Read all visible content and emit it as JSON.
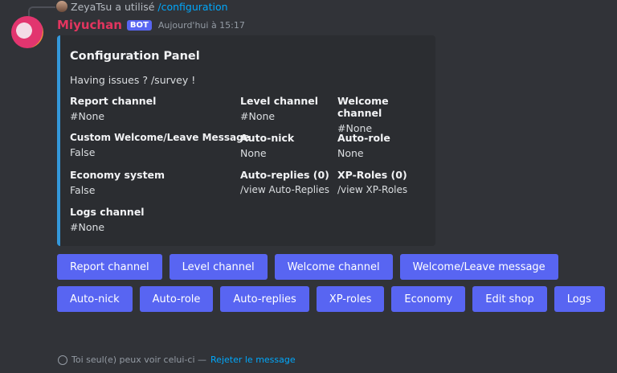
{
  "reply": {
    "user": "ZeyaTsu",
    "action": "a utilisé",
    "command": "/configuration"
  },
  "message": {
    "author": "Miyuchan",
    "badge": "BOT",
    "timestamp": "Aujourd'hui à 15:17"
  },
  "embed": {
    "color": "#3498db",
    "title": "Configuration Panel",
    "description": "Having issues ? /survey !",
    "fields": [
      {
        "name": "Report channel",
        "value": "#None"
      },
      {
        "name": "Level channel",
        "value": "#None"
      },
      {
        "name": "Welcome channel",
        "value": "#None"
      },
      {
        "name": "Custom Welcome/Leave Message",
        "value": "False"
      },
      {
        "name": "Auto-nick",
        "value": "None"
      },
      {
        "name": "Auto-role",
        "value": "None"
      },
      {
        "name": "Economy system",
        "value": "False"
      },
      {
        "name": "Auto-replies (0)",
        "value": "/view Auto-Replies"
      },
      {
        "name": "XP-Roles (0)",
        "value": "/view XP-Roles"
      },
      {
        "name": "Logs channel",
        "value": "#None"
      }
    ]
  },
  "buttons": [
    "Report channel",
    "Level channel",
    "Welcome channel",
    "Welcome/Leave message",
    "Auto-nick",
    "Auto-role",
    "Auto-replies",
    "XP-roles",
    "Economy",
    "Edit shop",
    "Logs"
  ],
  "footer": {
    "text": "Toi seul(e) peux voir celui-ci —",
    "dismiss": "Rejeter le message"
  }
}
